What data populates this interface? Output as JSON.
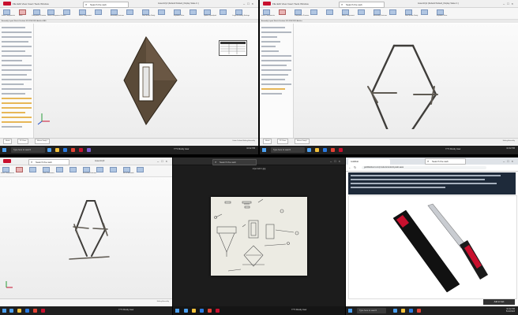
{
  "panes": {
    "top_left": {
      "app_title": "Assembly3 (Default<Default_Display State-1>)",
      "menu_text": "File Edit View Insert Tools Window",
      "search_label": "Search the web",
      "ribbon": [
        "Insert Components",
        "Mate",
        "Component Preview",
        "Linear Component Pattern",
        "Smart Fasteners",
        "Move Component",
        "Show Hidden Components",
        "Assembly Features",
        "Reference Geometry",
        "New Motion Study",
        "Bill of Materials",
        "Exploded View",
        "Instant3D",
        "Update Speedpak",
        "Take Snapshot",
        "Large Assembly Settings"
      ],
      "tabs": "Assembly  Layout  Sketch  Evaluate  SOLIDWORKS Add-Ins  MBD",
      "status_tabs": [
        "Model",
        "3D Views",
        "Motion Study 1"
      ],
      "status_text": "Under Defined   Editing Assembly"
    },
    "top_right": {
      "app_title": "Assembly4 (Default<Default_Display State-1>)",
      "menu_text": "File Edit View Insert Tools Window",
      "search_label": "Search the web",
      "ribbon": [
        "Insert Components",
        "Mate",
        "Component Preview",
        "Linear Component Pattern",
        "Smart Fasteners",
        "Move Component",
        "Show Hidden Components",
        "Assembly Features",
        "Reference Geometry",
        "New Motion Study",
        "Bill of Materials",
        "Exploded View"
      ],
      "tabs": "Assembly  Layout  Sketch  Evaluate  SOLIDWORKS Add-Ins",
      "status_tabs": [
        "Model",
        "3D Views",
        "Motion Study 1"
      ],
      "status_text": "Editing Assembly"
    },
    "bottom_left": {
      "app_title": "Assembly5",
      "search_label": "Search the web",
      "ribbon": [
        "Insert Components",
        "Mate",
        "Linear Component Pattern",
        "Smart Fasteners",
        "Move Component",
        "Show Hidden Components",
        "Assembly Features",
        "Reference Geometry",
        "New Motion Study",
        "Bill of Materials",
        "Exploded View"
      ],
      "status_text": "Editing Assembly"
    },
    "bottom_middle": {
      "image_name": "rope hold 1.jpg",
      "search_label": "Search the web"
    },
    "bottom_right": {
      "tab_label": "Goldblatt",
      "url": "goldblatttool.com/products/tools/drywall-saws",
      "search_label": "Search the web",
      "brand": "Goldblatt",
      "button_label": "Add to Cart"
    }
  },
  "taskbar": {
    "search_placeholder": "Type here to search",
    "weather": "77°F Mostly clear",
    "time": "10:42 PM",
    "date": "5/24/2023"
  },
  "colors": {
    "accent": "#c8102e",
    "taskbar": "#202020",
    "model": "#3f3d3a"
  }
}
